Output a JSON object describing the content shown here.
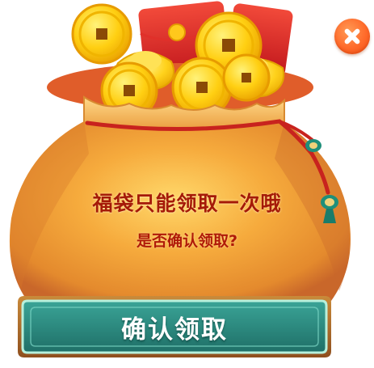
{
  "dialog": {
    "title": "福袋只能领取一次哦",
    "subtitle": "是否确认领取?",
    "confirm_label": "确认领取",
    "close_icon": "close-icon"
  },
  "colors": {
    "bag": "#f5a83a",
    "bag_shadow": "#d8772a",
    "title_text": "#a51a08",
    "button": "#2f8f84",
    "button_border": "#b7f0dc",
    "close_button": "#ff6a2a",
    "coin": "#ffc400",
    "red_envelope": "#d92024"
  }
}
